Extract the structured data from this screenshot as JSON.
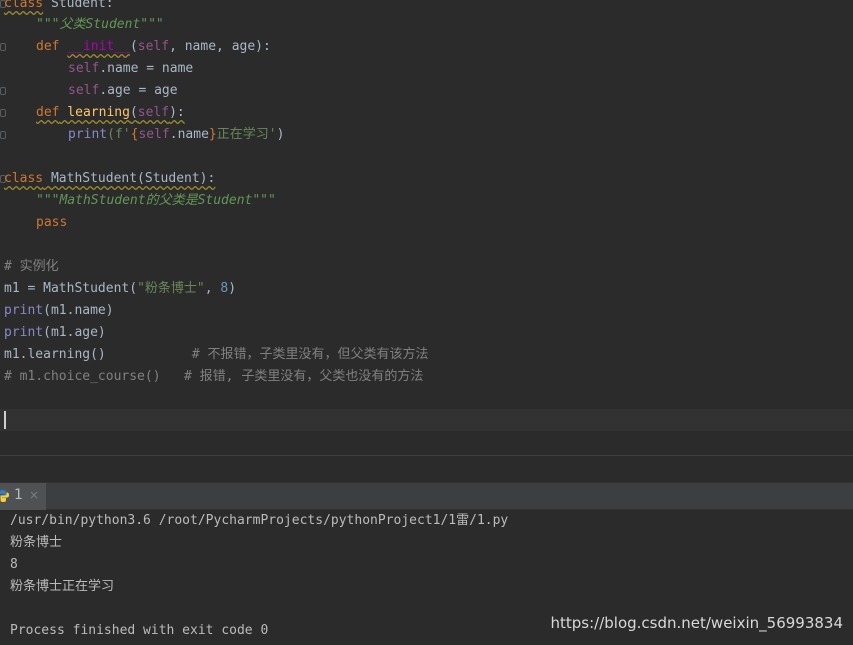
{
  "editor": {
    "lines": {
      "l1": {
        "kw": "class",
        "rest": " Student:"
      },
      "l2": {
        "doc": "\"\"\"父类Student\"\"\""
      },
      "l3": {
        "kw": "def",
        "sp": " ",
        "fn": "__init__",
        "open": "(",
        "self": "self",
        "params": ", name, age):"
      },
      "l4": {
        "self": "self",
        "rest": ".name = name"
      },
      "l5": {
        "self": "self",
        "rest": ".age = age"
      },
      "l6": {
        "kw": "def",
        "fn": " learning",
        "open": "(",
        "self": "self",
        "close": "):"
      },
      "l7": {
        "builtin": "print",
        "p1": "(f'",
        "brace_open": "{",
        "self": "self",
        "attr": ".name",
        "brace_close": "}",
        "str": "正在学习'",
        "close": ")"
      },
      "l8": {
        "kw": "class",
        "rest": " MathStudent(Student):"
      },
      "l9": {
        "doc": "\"\"\"MathStudent的父类是Student\"\"\""
      },
      "l10": {
        "kw": "pass"
      },
      "l11": {
        "cmt": "# 实例化"
      },
      "l12": {
        "var": "m1 = MathStudent(",
        "str": "\"粉条博士\"",
        "comma": ", ",
        "num": "8",
        "close": ")"
      },
      "l13": {
        "builtin": "print",
        "rest": "(m1.name)"
      },
      "l14": {
        "builtin": "print",
        "rest": "(m1.age)"
      },
      "l15": {
        "code": "m1.learning()           ",
        "cmt": "# 不报错，子类里没有，但父类有该方法"
      },
      "l16": {
        "cmt": "# m1.choice_course()   # 报错, 子类里没有，父类也没有的方法"
      }
    }
  },
  "run_panel": {
    "tab_label": "1",
    "close_symbol": "×",
    "tab_icon": "python-icon"
  },
  "console": {
    "lines": [
      "/usr/bin/python3.6 /root/PycharmProjects/pythonProject1/1雷/1.py",
      "粉条博士",
      "8",
      "粉条博士正在学习",
      "Process finished with exit code 0"
    ]
  },
  "watermark": "https://blog.csdn.net/weixin_56993834"
}
